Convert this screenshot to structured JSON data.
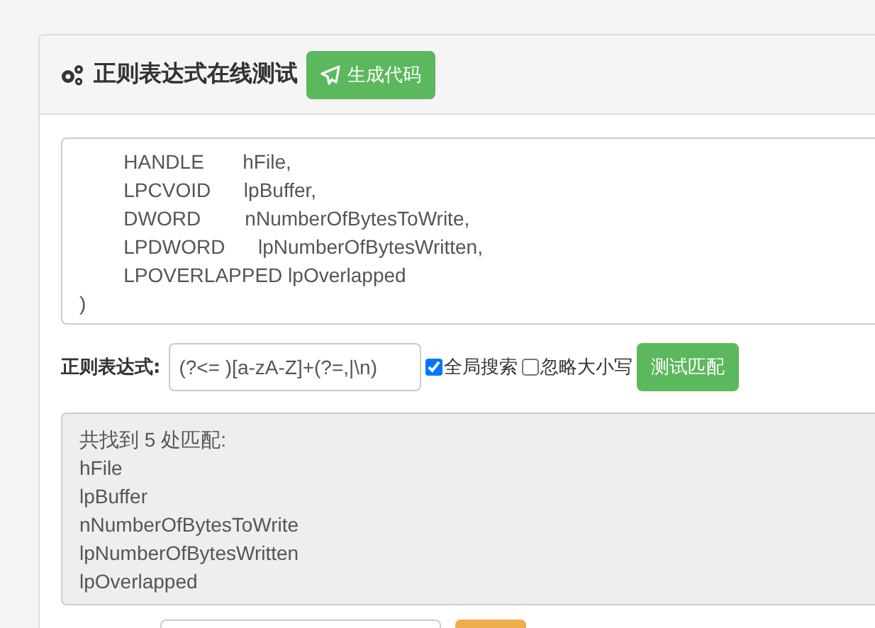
{
  "header": {
    "title": "正则表达式在线测试",
    "generate_button": "生成代码"
  },
  "source_text": {
    "lines": [
      "        HANDLE       hFile,",
      "        LPCVOID      lpBuffer,",
      "        DWORD        nNumberOfBytesToWrite,",
      "        LPDWORD      lpNumberOfBytesWritten,",
      "        LPOVERLAPPED lpOverlapped",
      ")"
    ]
  },
  "regex_row": {
    "label": "正则表达式:",
    "value": "(?<= )[a-zA-Z]+(?=,|\\n)",
    "options": [
      {
        "label": "全局搜索",
        "checked": true
      },
      {
        "label": "忽略大小写",
        "checked": false
      }
    ],
    "test_button": "测试匹配"
  },
  "result": {
    "summary": "共找到 5 处匹配:",
    "matches": [
      "hFile",
      "lpBuffer",
      "nNumberOfBytesToWrite",
      "lpNumberOfBytesWritten",
      "lpOverlapped"
    ]
  }
}
